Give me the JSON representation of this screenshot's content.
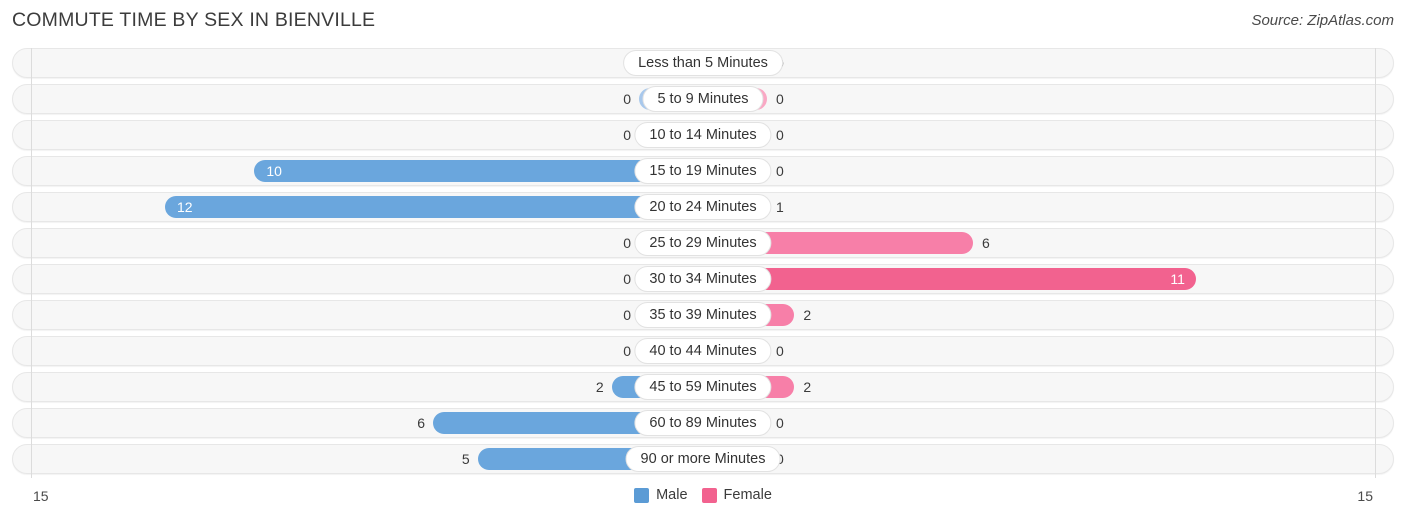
{
  "header": {
    "title": "COMMUTE TIME BY SEX IN BIENVILLE",
    "source": "Source: ZipAtlas.com"
  },
  "axis": {
    "left_label": "15",
    "right_label": "15"
  },
  "legend": {
    "items": [
      {
        "label": "Male",
        "color": "#5b9bd5"
      },
      {
        "label": "Female",
        "color": "#f2628f"
      }
    ]
  },
  "chart_data": {
    "type": "bar",
    "orientation": "horizontal-diverging",
    "title": "COMMUTE TIME BY SEX IN BIENVILLE",
    "xlabel": "",
    "ylabel": "",
    "xlim": [
      15,
      15
    ],
    "axis_max": 15,
    "grid": false,
    "legend_position": "bottom-center",
    "categories": [
      "Less than 5 Minutes",
      "5 to 9 Minutes",
      "10 to 14 Minutes",
      "15 to 19 Minutes",
      "20 to 24 Minutes",
      "25 to 29 Minutes",
      "30 to 34 Minutes",
      "35 to 39 Minutes",
      "40 to 44 Minutes",
      "45 to 59 Minutes",
      "60 to 89 Minutes",
      "90 or more Minutes"
    ],
    "series": [
      {
        "name": "Male",
        "values": [
          0,
          0,
          0,
          10,
          12,
          0,
          0,
          0,
          0,
          2,
          6,
          5
        ]
      },
      {
        "name": "Female",
        "values": [
          0,
          0,
          0,
          0,
          1,
          6,
          11,
          2,
          0,
          2,
          0,
          0
        ]
      }
    ]
  },
  "rows": [
    {
      "category": "Less than 5 Minutes",
      "male": "0",
      "female": "0",
      "male_inside": false,
      "female_inside": false
    },
    {
      "category": "5 to 9 Minutes",
      "male": "0",
      "female": "0",
      "male_inside": false,
      "female_inside": false
    },
    {
      "category": "10 to 14 Minutes",
      "male": "0",
      "female": "0",
      "male_inside": false,
      "female_inside": false
    },
    {
      "category": "15 to 19 Minutes",
      "male": "10",
      "female": "0",
      "male_inside": true,
      "female_inside": false
    },
    {
      "category": "20 to 24 Minutes",
      "male": "12",
      "female": "1",
      "male_inside": true,
      "female_inside": false
    },
    {
      "category": "25 to 29 Minutes",
      "male": "0",
      "female": "6",
      "male_inside": false,
      "female_inside": false
    },
    {
      "category": "30 to 34 Minutes",
      "male": "0",
      "female": "11",
      "male_inside": false,
      "female_inside": true
    },
    {
      "category": "35 to 39 Minutes",
      "male": "0",
      "female": "2",
      "male_inside": false,
      "female_inside": false
    },
    {
      "category": "40 to 44 Minutes",
      "male": "0",
      "female": "0",
      "male_inside": false,
      "female_inside": false
    },
    {
      "category": "45 to 59 Minutes",
      "male": "2",
      "female": "2",
      "male_inside": false,
      "female_inside": false
    },
    {
      "category": "60 to 89 Minutes",
      "male": "6",
      "female": "0",
      "male_inside": false,
      "female_inside": false
    },
    {
      "category": "90 or more Minutes",
      "male": "5",
      "female": "0",
      "male_inside": false,
      "female_inside": false
    }
  ]
}
